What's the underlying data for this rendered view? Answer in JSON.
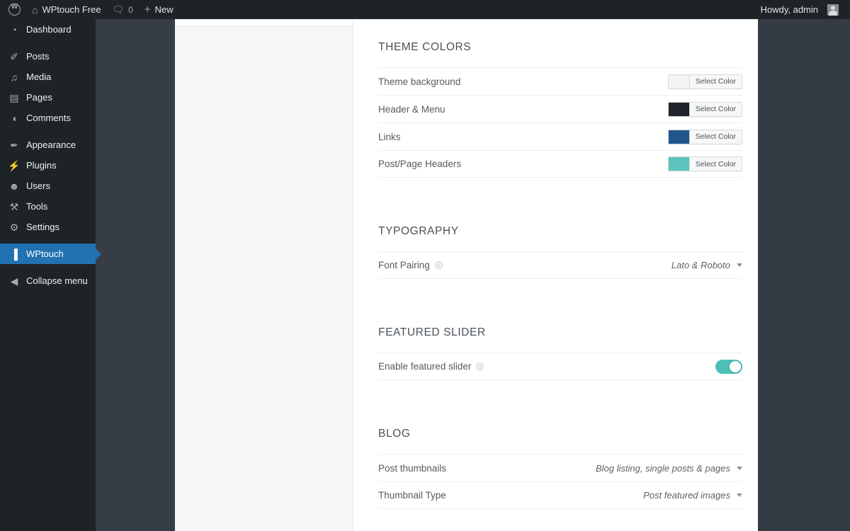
{
  "adminbar": {
    "site_name": "WPtouch Free",
    "comment_count": "0",
    "new_label": "New",
    "howdy": "Howdy, admin"
  },
  "sidebar": {
    "items": [
      {
        "label": "Dashboard",
        "icon": "dashboard-icon",
        "glyph": "◔",
        "current": false,
        "sep_after": true
      },
      {
        "label": "Posts",
        "icon": "pin-icon",
        "glyph": "✐",
        "current": false,
        "sep_after": false
      },
      {
        "label": "Media",
        "icon": "media-icon",
        "glyph": "♫",
        "current": false,
        "sep_after": false
      },
      {
        "label": "Pages",
        "icon": "pages-icon",
        "glyph": "▤",
        "current": false,
        "sep_after": false
      },
      {
        "label": "Comments",
        "icon": "comment-icon",
        "glyph": "◖",
        "current": false,
        "sep_after": true
      },
      {
        "label": "Appearance",
        "icon": "brush-icon",
        "glyph": "✒",
        "current": false,
        "sep_after": false
      },
      {
        "label": "Plugins",
        "icon": "plug-icon",
        "glyph": "⚡",
        "current": false,
        "sep_after": false
      },
      {
        "label": "Users",
        "icon": "user-icon",
        "glyph": "☻",
        "current": false,
        "sep_after": false
      },
      {
        "label": "Tools",
        "icon": "wrench-icon",
        "glyph": "⚒",
        "current": false,
        "sep_after": false
      },
      {
        "label": "Settings",
        "icon": "gear-icon",
        "glyph": "⚙",
        "current": false,
        "sep_after": true
      },
      {
        "label": "WPtouch",
        "icon": "wptouch-icon",
        "glyph": "▐",
        "current": true,
        "sep_after": true
      },
      {
        "label": "Collapse menu",
        "icon": "collapse-icon",
        "glyph": "◀",
        "current": false,
        "sep_after": false
      }
    ]
  },
  "content": {
    "sections": [
      {
        "title": "THEME COLORS",
        "type": "colors",
        "rows": [
          {
            "label": "Theme background",
            "color": "#f4f4f4",
            "button_label": "Select Color"
          },
          {
            "label": "Header & Menu",
            "color": "#1f232a",
            "button_label": "Select Color"
          },
          {
            "label": "Links",
            "color": "#21558c",
            "button_label": "Select Color"
          },
          {
            "label": "Post/Page Headers",
            "color": "#5cc4bd",
            "button_label": "Select Color"
          }
        ]
      },
      {
        "title": "TYPOGRAPHY",
        "type": "dropdowns",
        "rows": [
          {
            "label": "Font Pairing",
            "info": true,
            "value": "Lato & Roboto"
          }
        ]
      },
      {
        "title": "FEATURED SLIDER",
        "type": "toggles",
        "rows": [
          {
            "label": "Enable featured slider",
            "info": true,
            "enabled": true
          }
        ]
      },
      {
        "title": "BLOG",
        "type": "dropdowns",
        "rows": [
          {
            "label": "Post thumbnails",
            "info": false,
            "value": "Blog listing, single posts & pages"
          },
          {
            "label": "Thumbnail Type",
            "info": false,
            "value": "Post featured images"
          }
        ]
      }
    ]
  },
  "colors": {
    "accent": "#2271b1",
    "toggle_on": "#4cbfb6",
    "adminbar_bg": "#1d2327",
    "panel_dark": "#363d47"
  }
}
